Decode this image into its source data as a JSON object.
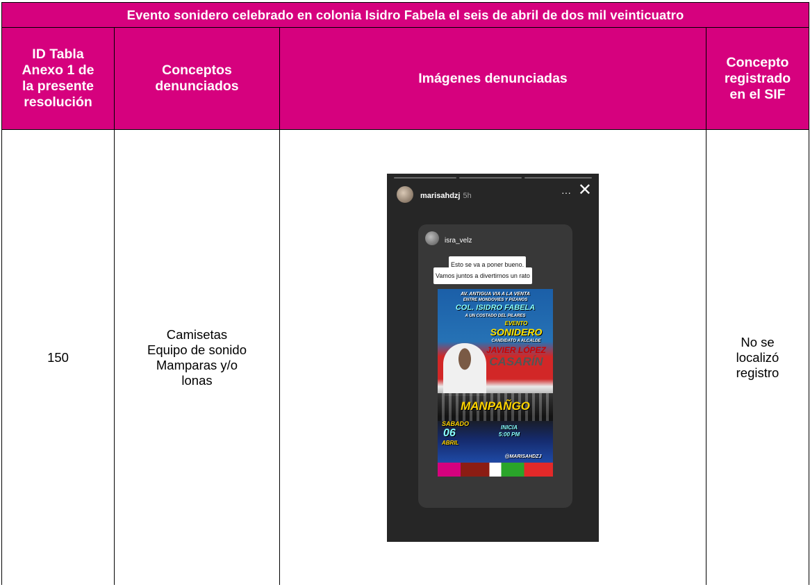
{
  "table": {
    "title": "Evento sonidero celebrado en colonia Isidro Fabela el seis de abril de dos mil veinticuatro",
    "headers": {
      "col1": [
        "ID Tabla",
        "Anexo 1 de",
        "la presente",
        "resolución"
      ],
      "col2": [
        "Conceptos",
        "denunciados"
      ],
      "col3": "Imágenes denunciadas",
      "col4": [
        "Concepto",
        "registrado",
        "en el SIF"
      ]
    },
    "row": {
      "id": "150",
      "concepts": [
        "Camisetas",
        "Equipo de sonido",
        "Mamparas y/o",
        "lonas"
      ],
      "sif": [
        "No se",
        "localizó",
        "registro"
      ]
    }
  },
  "image": {
    "user": "marisahdzj",
    "time": "5h",
    "dots": "···",
    "close": "✕",
    "shared_user": "isra_velz",
    "caption_1": "Esto se va a poner bueno.",
    "caption_2": "Vamos juntos a divertirnos un rato",
    "poster": {
      "l1": "AV. ANTIGUA VIA A LA VENTA",
      "l2": "ENTRE MONDOVIES Y PIZANOS",
      "l3": "COL. ISIDRO FABELA",
      "l4": "A UN COSTADO DEL PILARES",
      "l5": "EVENTO",
      "l6": "SONIDERO",
      "l7": "CANDIDATO A ALCALDE",
      "l8": "JAVIER LÓPEZ",
      "l9": "CASARÍN",
      "l10": "MANPAÑGO",
      "l11": "SABADO",
      "l12": "06",
      "l13": "ABRIL",
      "l14": "INICIA",
      "l15": "5:00 PM",
      "l16": "@MARISAHDZJ"
    },
    "colors": {
      "accent": "#d6017e"
    }
  }
}
